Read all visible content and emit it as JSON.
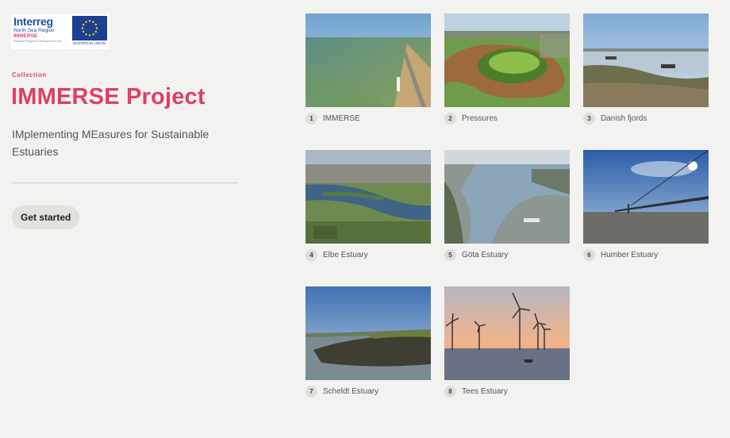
{
  "logo": {
    "brand": "Interreg",
    "region": "North Sea Region",
    "project": "IMMERSE",
    "fund": "European Regional Development Fund",
    "eu_label": "EUROPEAN UNION"
  },
  "collection": {
    "eyebrow": "Collection",
    "title": "IMMERSE Project",
    "subtitle": "IMplementing MEasures for Sustainable Estuaries",
    "cta_label": "Get started"
  },
  "colors": {
    "accent": "#dd3f66",
    "background": "#f2f2f0",
    "button_bg": "#e3e1de"
  },
  "cards": [
    {
      "number": "1",
      "label": "IMMERSE"
    },
    {
      "number": "2",
      "label": "Pressures"
    },
    {
      "number": "3",
      "label": "Danish fjords"
    },
    {
      "number": "4",
      "label": "Elbe Estuary"
    },
    {
      "number": "5",
      "label": "Göta Estuary"
    },
    {
      "number": "6",
      "label": "Humber Estuary"
    },
    {
      "number": "7",
      "label": "Scheldt Estuary"
    },
    {
      "number": "8",
      "label": "Tees Estuary"
    }
  ]
}
